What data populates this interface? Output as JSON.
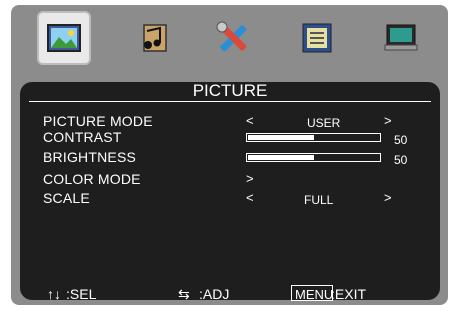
{
  "tabs": [
    {
      "icon": "picture-icon",
      "active": true
    },
    {
      "icon": "audio-icon",
      "active": false
    },
    {
      "icon": "settings-tools-icon",
      "active": false
    },
    {
      "icon": "osd-icon",
      "active": false
    },
    {
      "icon": "display-icon",
      "active": false
    }
  ],
  "menu": {
    "title": "PICTURE",
    "rows": [
      {
        "label": "PICTURE  MODE",
        "value": "USER",
        "left_arrow": "<",
        "right_arrow": ">"
      },
      {
        "label": "CONTRAST",
        "value": "50",
        "level": 0.5
      },
      {
        "label": "BRIGHTNESS",
        "value": "50",
        "level": 0.5
      },
      {
        "label": "COLOR MODE",
        "right_arrow": ">"
      },
      {
        "label": "SCALE",
        "value": "FULL",
        "left_arrow": "<",
        "right_arrow": ">"
      }
    ]
  },
  "footer": {
    "sel_symbol": "↑↓",
    "sel_label": ":SEL",
    "adj_symbol": "⇆",
    "adj_label": ":ADJ",
    "menu_key": "MENU",
    "exit_label": ":EXIT"
  }
}
